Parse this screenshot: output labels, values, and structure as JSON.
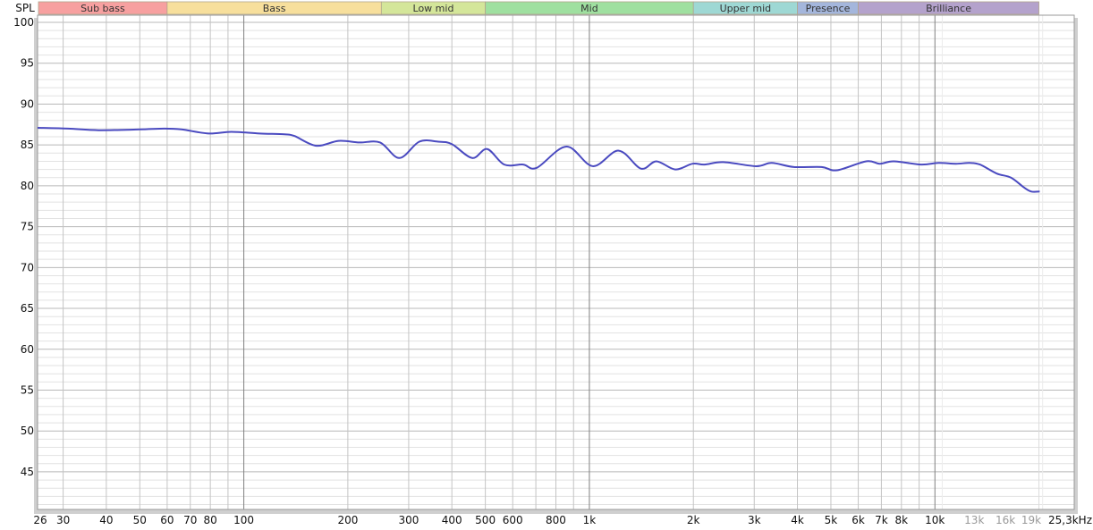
{
  "chart_data": {
    "type": "line",
    "title": "",
    "ylabel": "SPL",
    "xlabel": "",
    "xscale": "log",
    "xlim": [
      25.3,
      25300
    ],
    "ylim": [
      40.4,
      100
    ],
    "grid": true,
    "y_ticks": [
      100,
      95,
      90,
      85,
      80,
      75,
      70,
      65,
      60,
      55,
      50,
      45
    ],
    "x_ticks": [
      {
        "value": 26,
        "label": "26"
      },
      {
        "value": 30,
        "label": "30"
      },
      {
        "value": 40,
        "label": "40"
      },
      {
        "value": 50,
        "label": "50"
      },
      {
        "value": 60,
        "label": "60"
      },
      {
        "value": 70,
        "label": "70"
      },
      {
        "value": 80,
        "label": "80"
      },
      {
        "value": 100,
        "label": "100"
      },
      {
        "value": 200,
        "label": "200"
      },
      {
        "value": 300,
        "label": "300"
      },
      {
        "value": 400,
        "label": "400"
      },
      {
        "value": 500,
        "label": "500"
      },
      {
        "value": 600,
        "label": "600"
      },
      {
        "value": 800,
        "label": "800"
      },
      {
        "value": 1000,
        "label": "1k"
      },
      {
        "value": 2000,
        "label": "2k"
      },
      {
        "value": 3000,
        "label": "3k"
      },
      {
        "value": 4000,
        "label": "4k"
      },
      {
        "value": 5000,
        "label": "5k"
      },
      {
        "value": 6000,
        "label": "6k"
      },
      {
        "value": 7000,
        "label": "7k"
      },
      {
        "value": 8000,
        "label": "8k"
      },
      {
        "value": 10000,
        "label": "10k"
      },
      {
        "value": 13000,
        "label": "13k",
        "muted": true
      },
      {
        "value": 16000,
        "label": "16k",
        "muted": true
      },
      {
        "value": 19000,
        "label": "19k",
        "muted": true
      },
      {
        "value": 25300,
        "label": "25,3kHz"
      }
    ],
    "bands": [
      {
        "label": "Sub bass",
        "from": 25.3,
        "to": 60,
        "color": "#f7a0a0"
      },
      {
        "label": "Bass",
        "from": 60,
        "to": 250,
        "color": "#f7df9c"
      },
      {
        "label": "Low mid",
        "from": 250,
        "to": 500,
        "color": "#d4e69a"
      },
      {
        "label": "Mid",
        "from": 500,
        "to": 2000,
        "color": "#9fe0a0"
      },
      {
        "label": "Upper mid",
        "from": 2000,
        "to": 4000,
        "color": "#9ed8d4"
      },
      {
        "label": "Presence",
        "from": 4000,
        "to": 6000,
        "color": "#a4b6dc"
      },
      {
        "label": "Brilliance",
        "from": 6000,
        "to": 20000,
        "color": "#b4a2cc"
      }
    ],
    "series": [
      {
        "name": "SPL",
        "color": "#4a4ac0",
        "x": [
          25.3,
          31,
          38,
          50,
          59,
          66,
          79,
          92,
          111,
          131,
          140,
          162,
          188,
          216,
          248,
          282,
          322,
          365,
          400,
          458,
          506,
          567,
          643,
          704,
          858,
          1023,
          1215,
          1410,
          1563,
          1772,
          1988,
          2153,
          2443,
          3037,
          3370,
          3906,
          4694,
          5204,
          6323,
          6927,
          7603,
          9116,
          10240,
          11500,
          12600,
          13500,
          15100,
          16600,
          18100,
          19000,
          20100
        ],
        "y": [
          87.1,
          87.0,
          86.8,
          86.9,
          87.0,
          86.9,
          86.4,
          86.6,
          86.4,
          86.3,
          86.1,
          84.9,
          85.5,
          85.3,
          85.3,
          83.4,
          85.4,
          85.4,
          85.1,
          83.4,
          84.5,
          82.6,
          82.6,
          82.2,
          84.8,
          82.4,
          84.3,
          82.1,
          83.0,
          82.0,
          82.7,
          82.6,
          82.9,
          82.4,
          82.8,
          82.3,
          82.3,
          81.9,
          83.0,
          82.7,
          83.0,
          82.6,
          82.8,
          82.7,
          82.8,
          82.6,
          81.5,
          81.0,
          79.8,
          79.3,
          79.3
        ]
      }
    ]
  }
}
